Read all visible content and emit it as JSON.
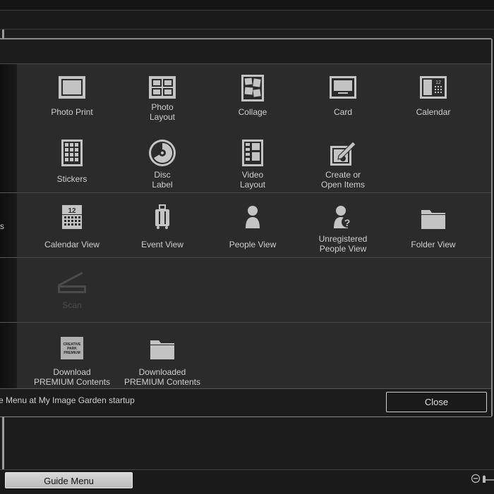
{
  "dialog": {
    "sidebar": {
      "partial_label": "s"
    },
    "sections": [
      {
        "id": "create",
        "items": [
          {
            "label_lines": [
              "Photo Print"
            ],
            "icon": "photo-print-icon"
          },
          {
            "label_lines": [
              "Photo",
              "Layout"
            ],
            "icon": "photo-layout-icon"
          },
          {
            "label_lines": [
              "Collage"
            ],
            "icon": "collage-icon"
          },
          {
            "label_lines": [
              "Card"
            ],
            "icon": "card-icon"
          },
          {
            "label_lines": [
              "Calendar"
            ],
            "icon": "calendar-icon"
          },
          {
            "label_lines": [
              "Stickers"
            ],
            "icon": "stickers-icon"
          },
          {
            "label_lines": [
              "Disc",
              "Label"
            ],
            "icon": "disc-label-icon"
          },
          {
            "label_lines": [
              "Video",
              "Layout"
            ],
            "icon": "video-layout-icon"
          },
          {
            "label_lines": [
              "Create or",
              "Open Items"
            ],
            "icon": "create-open-items-icon"
          }
        ]
      },
      {
        "id": "views",
        "items": [
          {
            "label_lines": [
              "Calendar View"
            ],
            "icon": "calendar-view-icon",
            "badge": "12"
          },
          {
            "label_lines": [
              "Event View"
            ],
            "icon": "event-view-icon"
          },
          {
            "label_lines": [
              "People View"
            ],
            "icon": "people-view-icon"
          },
          {
            "label_lines": [
              "Unregistered",
              "People View"
            ],
            "icon": "unregistered-people-view-icon"
          },
          {
            "label_lines": [
              "Folder View"
            ],
            "icon": "folder-view-icon"
          }
        ]
      },
      {
        "id": "scan",
        "items": [
          {
            "label_lines": [
              "Scan"
            ],
            "icon": "scan-icon",
            "disabled": true
          }
        ]
      },
      {
        "id": "premium",
        "items": [
          {
            "label_lines": [
              "Download",
              "PREMIUM Contents"
            ],
            "icon": "creative-park-premium-icon",
            "logo_text": [
              "CREATIVE",
              "PARK",
              "PREMIUM"
            ]
          },
          {
            "label_lines": [
              "Downloaded",
              "PREMIUM Contents"
            ],
            "icon": "downloaded-folder-icon"
          }
        ]
      }
    ],
    "footer": {
      "startup_text": "e Menu at My Image Garden startup",
      "close_label": "Close"
    },
    "calendar_icon_number": "12"
  },
  "app": {
    "guide_menu_label": "Guide Menu"
  },
  "colors": {
    "icon_fill": "#c4c4c4",
    "icon_dark": "#2b2b2b",
    "disabled": "#4a4a4a",
    "content_bg": "#2b2b2b"
  }
}
